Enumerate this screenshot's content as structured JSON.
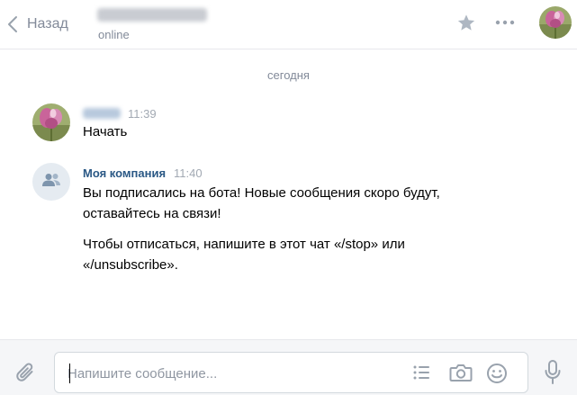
{
  "header": {
    "back_label": "Назад",
    "contact_status": "online"
  },
  "chat": {
    "date_separator": "сегодня",
    "messages": [
      {
        "author": "",
        "time": "11:39",
        "lines": [
          "Начать"
        ]
      },
      {
        "author": "Моя компания",
        "time": "11:40",
        "paragraph1_line1": "Вы подписались на бота! Новые сообщения скоро будут,",
        "paragraph1_line2": "оставайтесь на связи!",
        "paragraph2_line1": "Чтобы отписаться, напишите в этот чат «/stop» или",
        "paragraph2_line2": "«/unsubscribe»."
      }
    ]
  },
  "composer": {
    "placeholder": "Напишите сообщение...",
    "value": ""
  },
  "icons": {
    "back": "chevron-left-icon",
    "star": "star-icon",
    "more": "more-horizontal-icon",
    "group_avatar": "users-icon",
    "attach": "paperclip-icon",
    "list": "list-icon",
    "camera": "camera-icon",
    "emoji": "smile-icon",
    "microphone": "microphone-icon"
  },
  "colors": {
    "accent_link": "#2a5885",
    "muted_text": "#828a99",
    "icon_gray": "#99a2ad",
    "composer_bg": "#f5f6f8"
  }
}
